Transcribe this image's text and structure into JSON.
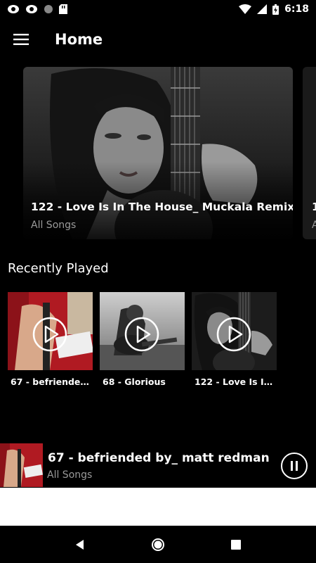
{
  "status_bar": {
    "time": "6:18",
    "left_icons": [
      "notification-icon",
      "notification-icon",
      "record-icon",
      "sd-card-icon"
    ],
    "right_icons": [
      "wifi-icon",
      "signal-icon",
      "battery-charging-icon"
    ]
  },
  "app_bar": {
    "menu_icon": "hamburger-menu-icon",
    "title": "Home"
  },
  "hero": {
    "items": [
      {
        "title": "122 - Love Is In The House_ Muckala Remix",
        "subtitle": "All Songs"
      },
      {
        "title": "1",
        "subtitle": "A"
      }
    ]
  },
  "recently_played": {
    "heading": "Recently Played",
    "items": [
      {
        "title": "67 - befriended ..."
      },
      {
        "title": "68 - Glorious"
      },
      {
        "title": "122 - Love Is In ..."
      }
    ]
  },
  "mini_player": {
    "title": "67 - befriended by_ matt redman ..",
    "subtitle": "All Songs",
    "control_icon": "pause-icon"
  },
  "nav_bar": {
    "icons": [
      "back-icon",
      "home-icon",
      "recents-icon"
    ]
  },
  "colors": {
    "background": "#000000",
    "secondary_text": "#9a9a9a",
    "strip": "#ffffff"
  }
}
